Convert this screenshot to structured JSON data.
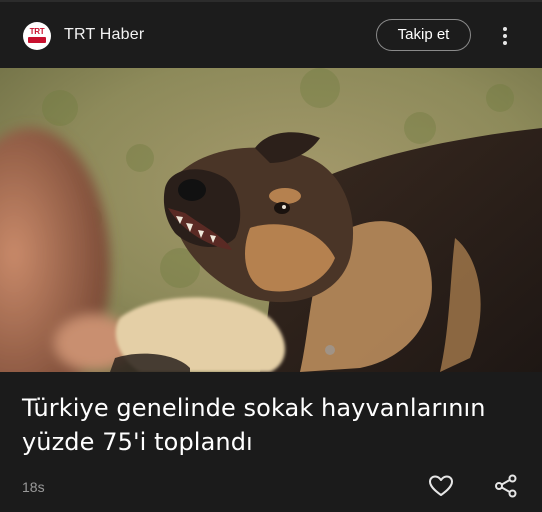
{
  "header": {
    "logo_text": "TRT",
    "logo_subtext": "HABER",
    "source_name": "TRT Haber",
    "follow_label": "Takip et",
    "more_icon": "more-vert-icon"
  },
  "article": {
    "image_alt": "dog",
    "headline": "Türkiye genelinde sokak hayvanlarının yüzde 75'i toplandı",
    "time": "18s"
  },
  "actions": {
    "like_icon": "heart-icon",
    "share_icon": "share-icon"
  },
  "colors": {
    "background": "#1b1b1b",
    "brand_red": "#c8102e",
    "muted_text": "#9a9a9a"
  }
}
